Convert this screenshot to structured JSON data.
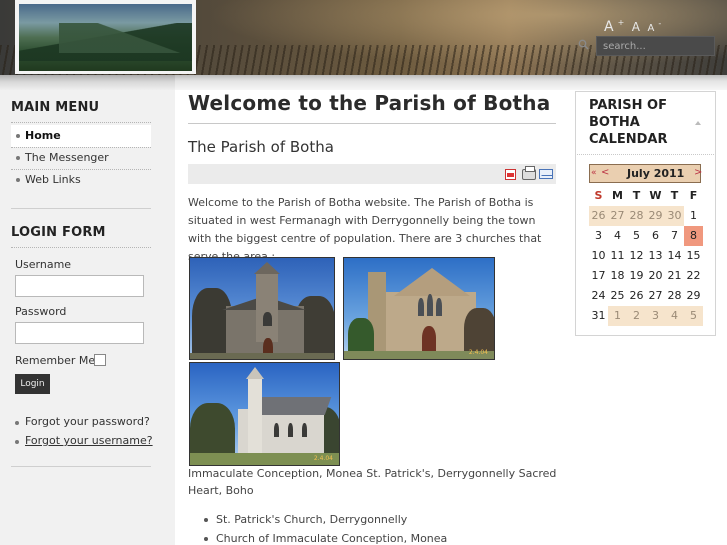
{
  "header": {
    "font_tools": {
      "larger": "A",
      "larger_sup": "+",
      "reset": "A",
      "smaller": "A",
      "smaller_sup": "-"
    },
    "search": {
      "placeholder": "search..."
    }
  },
  "sidebar": {
    "main_menu": {
      "heading": "MAIN MENU",
      "items": [
        {
          "label": "Home",
          "active": true
        },
        {
          "label": "The Messenger",
          "active": false
        },
        {
          "label": "Web Links",
          "active": false
        }
      ]
    },
    "login_form": {
      "heading": "LOGIN FORM",
      "username_label": "Username",
      "username_value": "",
      "password_label": "Password",
      "password_value": "",
      "remember_label": "Remember Me",
      "remember_checked": false,
      "login_button": "Login",
      "forgot_password": "Forgot your password?",
      "forgot_username": "Forgot your username?"
    }
  },
  "main": {
    "page_title": "Welcome to the Parish of Botha",
    "article_title": "The Parish of Botha",
    "intro": "Welcome to the Parish of Botha website. The Parish of Botha is situated in west Fermanagh with Derrygonnelly being the town with the biggest centre of population. There are 3 churches that serve the area :",
    "photos": [
      {
        "icon": "church-photo-monea",
        "stamp": ""
      },
      {
        "icon": "church-photo-derrygonnelly",
        "stamp": "2.4.04"
      },
      {
        "icon": "church-photo-boho",
        "stamp": "2.4.04"
      }
    ],
    "caption": "Immaculate Conception, Monea    St. Patrick's, Derrygonnelly     Sacred Heart, Boho",
    "list": [
      "St. Patrick's Church, Derrygonnelly",
      "Church of Immaculate Conception, Monea"
    ]
  },
  "calendar": {
    "heading": "PARISH OF BOTHA CALENDAR",
    "nav_prev_year": "«",
    "nav_prev": "<",
    "month_label": "July 2011",
    "nav_next": ">",
    "weekdays": [
      "S",
      "M",
      "T",
      "W",
      "T",
      "F"
    ],
    "weeks": [
      [
        "26",
        "27",
        "28",
        "29",
        "30",
        "1"
      ],
      [
        "3",
        "4",
        "5",
        "6",
        "7",
        "8"
      ],
      [
        "10",
        "11",
        "12",
        "13",
        "14",
        "15"
      ],
      [
        "17",
        "18",
        "19",
        "20",
        "21",
        "22"
      ],
      [
        "24",
        "25",
        "26",
        "27",
        "28",
        "29"
      ],
      [
        "31",
        "1",
        "2",
        "3",
        "4",
        "5"
      ]
    ],
    "today": "8",
    "colors": {
      "nav_bg": "#eacfb0",
      "today_bg": "#f0987e",
      "outside_bg": "#f6e4cc",
      "sunday": "#c0392b"
    }
  }
}
